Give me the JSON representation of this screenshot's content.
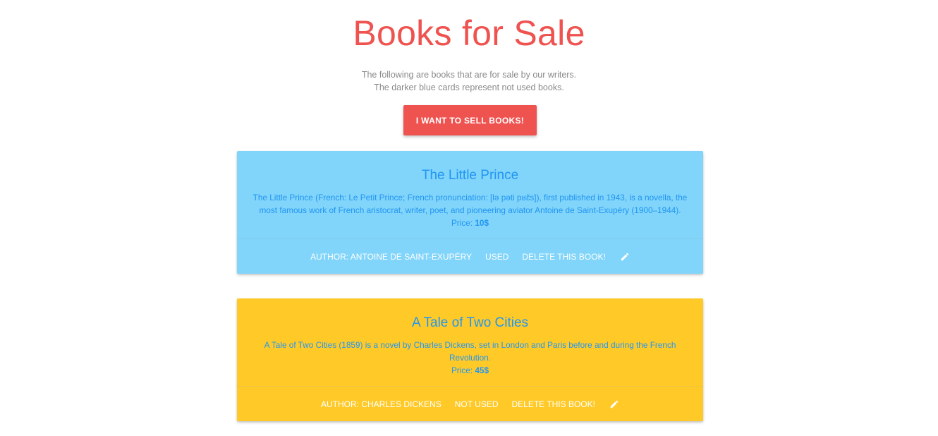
{
  "header": {
    "title": "Books for Sale",
    "intro_line1": "The following are books that are for sale by our writers.",
    "intro_line2": "The darker blue cards represent not used books.",
    "sell_button_label": "I WANT TO SELL BOOKS!"
  },
  "books": [
    {
      "title": "The Little Prince",
      "description": "The Little Prince (French: Le Petit Prince; French pronunciation: [lə pəti pʁɛ̃s]), first published in 1943, is a novella, the most famous work of French aristocrat, writer, poet, and pioneering aviator Antoine de Saint-Exupéry (1900–1944).",
      "price_label": "Price:",
      "price": "10$",
      "author_label": "AUTHOR: ANTOINE DE SAINT-EXUPÉRY",
      "condition": "USED",
      "delete_label": "DELETE THIS BOOK!",
      "card_color": "#81d4fa",
      "edit_icon": "pencil-icon"
    },
    {
      "title": "A Tale of Two Cities",
      "description": "A Tale of Two Cities (1859) is a novel by Charles Dickens, set in London and Paris before and during the French Revolution.",
      "price_label": "Price:",
      "price": "45$",
      "author_label": "AUTHOR: CHARLES DICKENS",
      "condition": "NOT USED",
      "delete_label": "DELETE THIS BOOK!",
      "card_color": "#ffca28",
      "edit_icon": "pencil-icon"
    }
  ],
  "colors": {
    "accent": "#ef5350",
    "card_text": "#2196f3",
    "intro_text": "#8a8a8a"
  }
}
